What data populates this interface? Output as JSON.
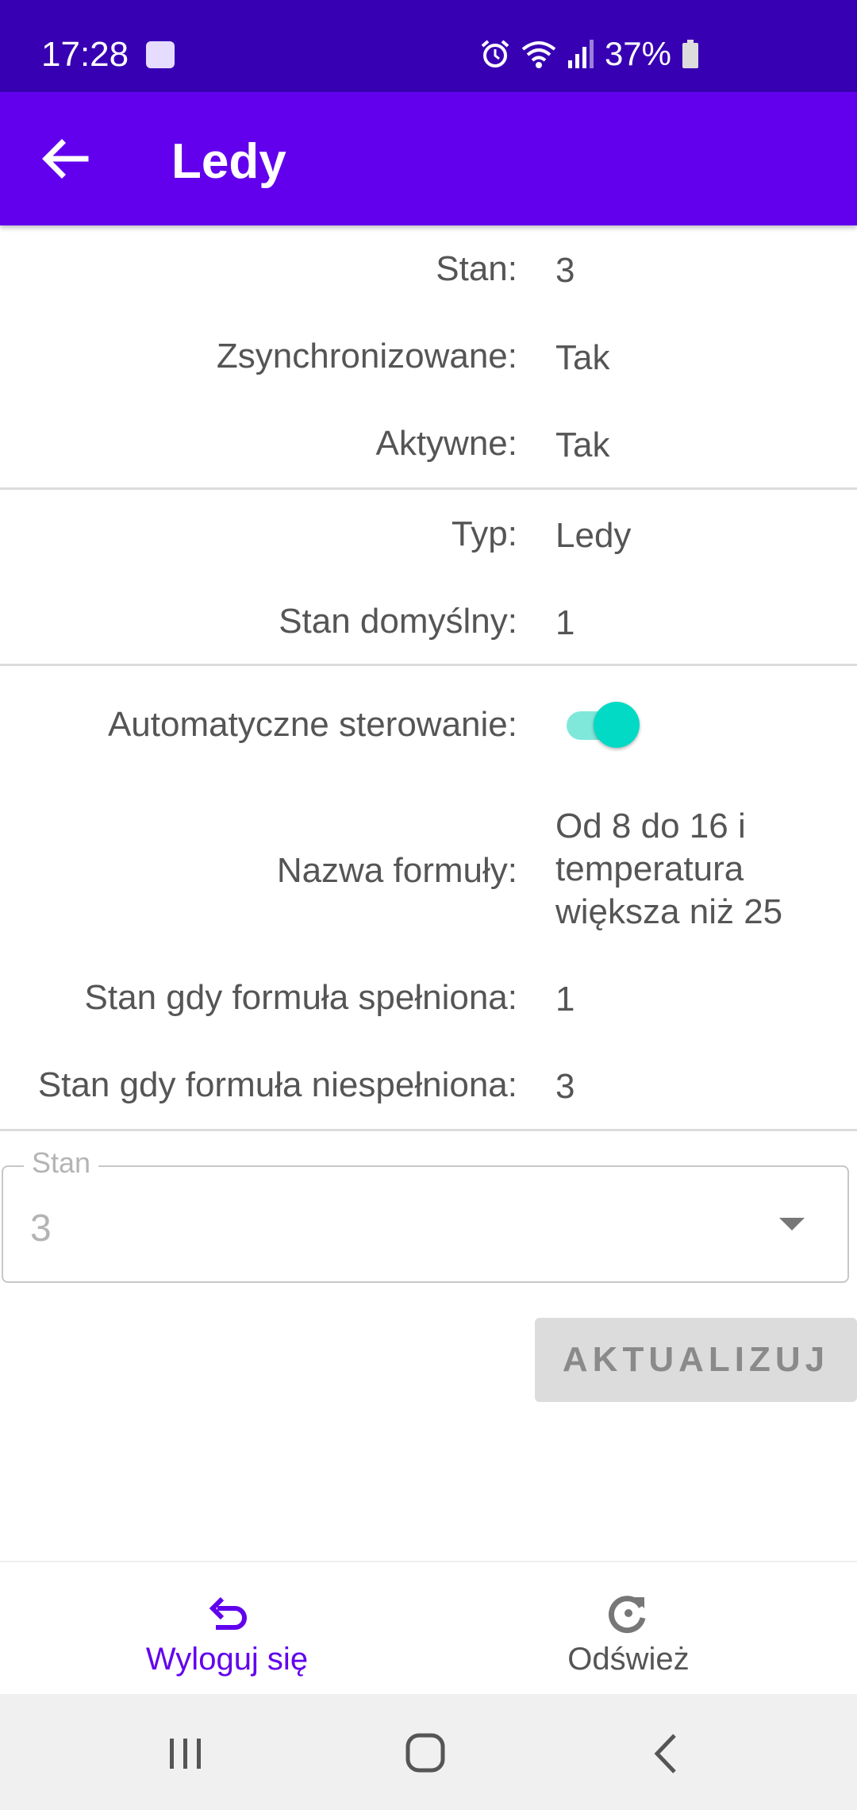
{
  "status_bar": {
    "time": "17:28",
    "battery": "37%"
  },
  "app_bar": {
    "title": "Ledy"
  },
  "details": {
    "stan": {
      "label": "Stan:",
      "value": "3"
    },
    "zsynchronizowane": {
      "label": "Zsynchronizowane:",
      "value": "Tak"
    },
    "aktywne": {
      "label": "Aktywne:",
      "value": "Tak"
    },
    "typ": {
      "label": "Typ:",
      "value": "Ledy"
    },
    "stan_domyslny": {
      "label": "Stan domyślny:",
      "value": "1"
    },
    "automatyczne": {
      "label": "Automatyczne sterowanie:",
      "enabled": true
    },
    "formula": {
      "label": "Nazwa formuły:",
      "value_lines": [
        "Od 8 do 16 i",
        "temperatura",
        "większa niż 25"
      ]
    },
    "stan_spelniona": {
      "label": "Stan gdy formuła spełniona:",
      "value": "1"
    },
    "stan_niespelniona": {
      "label": "Stan gdy formuła niespełniona:",
      "value": "3"
    }
  },
  "select": {
    "label": "Stan",
    "value": "3"
  },
  "update_button": {
    "label": "AKTUALIZUJ"
  },
  "bottom_nav": {
    "logout": {
      "label": "Wyloguj się",
      "icon": "undo-icon",
      "color": "#6200ee"
    },
    "refresh": {
      "label": "Odśwież",
      "icon": "refresh-icon",
      "color": "#555555"
    }
  },
  "colors": {
    "status_bar": "#3700b3",
    "app_bar": "#6200ee",
    "switch_on": "#03dac5"
  }
}
